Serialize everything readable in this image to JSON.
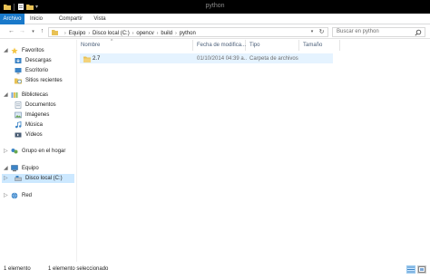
{
  "window": {
    "title": "python"
  },
  "ribbon": {
    "tabs": [
      "Archivo",
      "Inicio",
      "Compartir",
      "Vista"
    ]
  },
  "address": {
    "crumbs": [
      "Equipo",
      "Disco local (C:)",
      "opencv",
      "build",
      "python"
    ]
  },
  "search": {
    "placeholder": "Buscar en python"
  },
  "sidebar": {
    "favorites": {
      "label": "Favoritos",
      "items": [
        "Descargas",
        "Escritorio",
        "Sitios recientes"
      ]
    },
    "libraries": {
      "label": "Bibliotecas",
      "items": [
        "Documentos",
        "Imágenes",
        "Música",
        "Vídeos"
      ]
    },
    "homegroup": {
      "label": "Grupo en el hogar"
    },
    "computer": {
      "label": "Equipo",
      "items": [
        "Disco local (C:)"
      ]
    },
    "network": {
      "label": "Red"
    }
  },
  "columns": [
    "Nombre",
    "Fecha de modifica...",
    "Tipo",
    "Tamaño"
  ],
  "rows": [
    {
      "name": "2.7",
      "date": "01/10/2014 04:39 a...",
      "type": "Carpeta de archivos",
      "size": ""
    }
  ],
  "status": {
    "count": "1 elemento",
    "selected": "1 elemento seleccionado"
  },
  "colors": {
    "accent": "#1979ca",
    "selection": "#cce8ff",
    "hover_row": "#e5f3ff",
    "folder": "#e8c155"
  }
}
